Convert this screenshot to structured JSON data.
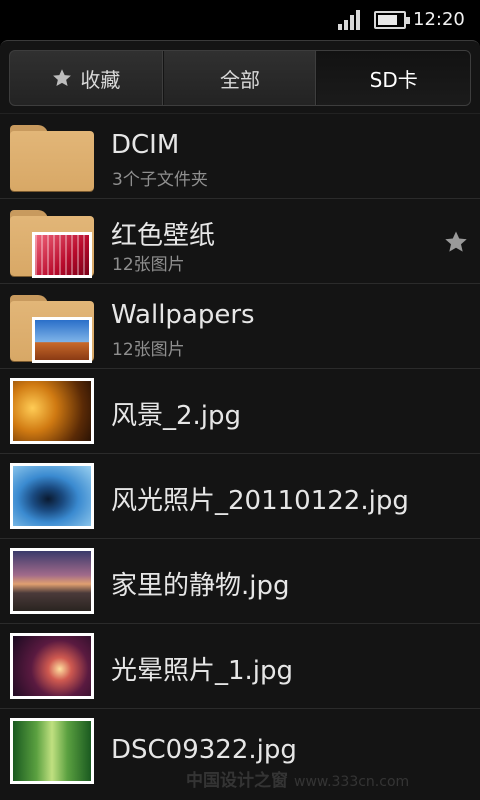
{
  "status_bar": {
    "time": "12:20",
    "battery_level": 0.8,
    "signal_icon": "signal-icon",
    "battery_icon": "battery-icon"
  },
  "tabs": [
    {
      "label": "收藏",
      "icon": "star-icon",
      "active": false
    },
    {
      "label": "全部",
      "active": false
    },
    {
      "label": "SD卡",
      "active": true
    }
  ],
  "items": [
    {
      "kind": "folder",
      "name": "DCIM",
      "sub": "3个子文件夹"
    },
    {
      "kind": "folder",
      "name": "红色壁纸",
      "sub": "12张图片",
      "favorite": true
    },
    {
      "kind": "folder",
      "name": "Wallpapers",
      "sub": "12张图片"
    },
    {
      "kind": "file",
      "name": "风景_2.jpg"
    },
    {
      "kind": "file",
      "name": "风光照片_20110122.jpg"
    },
    {
      "kind": "file",
      "name": "家里的静物.jpg"
    },
    {
      "kind": "file",
      "name": "光晕照片_1.jpg"
    },
    {
      "kind": "file",
      "name": "DSC09322.jpg"
    }
  ],
  "watermark": {
    "text": "中国设计之窗",
    "url": "www.333cn.com"
  },
  "colors": {
    "folder": "#dcae6e",
    "background": "#141414",
    "tab_active": "#121212"
  }
}
